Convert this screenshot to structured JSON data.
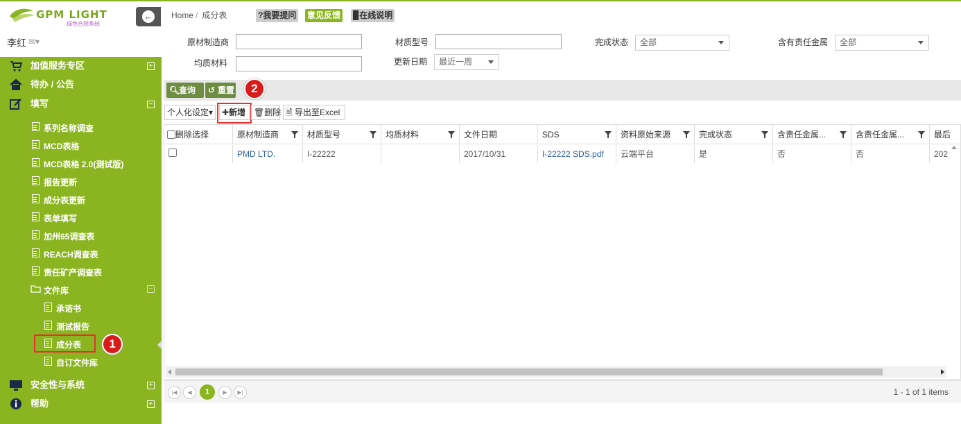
{
  "brand": {
    "logo_text": "GPM LIGHT",
    "logo_sub": "绿色合规系统"
  },
  "user": {
    "name": "李红"
  },
  "sidebar": {
    "menu": [
      {
        "label": "加值服务专区",
        "toggle": "+"
      },
      {
        "label": "待办 / 公告"
      },
      {
        "label": "填写",
        "toggle": "−"
      }
    ],
    "fill_items": [
      "系列名称调查",
      "MCD表格",
      "MCD表格 2.0(测试版)",
      "报告更新",
      "成分表更新",
      "表单填写",
      "加州65调查表",
      "REACH调查表",
      "责任矿产调查表"
    ],
    "library": {
      "label": "文件库",
      "toggle": "−",
      "items": [
        "承诺书",
        "测试报告",
        "成分表",
        "自订文件库"
      ]
    },
    "bottom_menu": [
      {
        "label": "安全性与系统",
        "toggle": "+"
      },
      {
        "label": "帮助",
        "toggle": "+"
      }
    ]
  },
  "annotations": {
    "badge1": "1",
    "badge2": "2"
  },
  "breadcrumb": {
    "home": "Home",
    "sep": "/",
    "current": "成分表"
  },
  "top_buttons": {
    "question": "?我要提问",
    "feedback": "意见反馈",
    "help": "在线说明"
  },
  "filters": {
    "manufacturer_label": "原材制造商",
    "material_no_label": "材质型号",
    "status_label": "完成状态",
    "status_value": "全部",
    "metal_label": "含有责任金属",
    "metal_value": "全部",
    "homogeneous_label": "均质材料",
    "update_date_label": "更新日期",
    "update_date_value": "最近一周"
  },
  "toolbar": {
    "query": "查询",
    "reset": "重置"
  },
  "grid_toolbar": {
    "personal": "个人化设定",
    "add": "新增",
    "delete": "删除",
    "export": "导出至Excel"
  },
  "table": {
    "columns": [
      "删除选择",
      "原材制造商",
      "材质型号",
      "均质材料",
      "文件日期",
      "SDS",
      "资料原始来源",
      "完成状态",
      "含责任金属...",
      "含责任金属...",
      "最后"
    ],
    "rows": [
      {
        "manufacturer": "PMD LTD.",
        "material_no": "I-22222",
        "homogeneous": "",
        "date": "2017/10/31",
        "sds": "I-22222 SDS.pdf",
        "source": "云端平台",
        "status": "是",
        "metal1": "否",
        "metal2": "否",
        "last": "202"
      }
    ]
  },
  "pager": {
    "current": "1",
    "info": "1 - 1 of 1 items"
  },
  "colors": {
    "accent": "#8ab521",
    "dark_green": "#6d8e42",
    "highlight": "#e53030"
  }
}
